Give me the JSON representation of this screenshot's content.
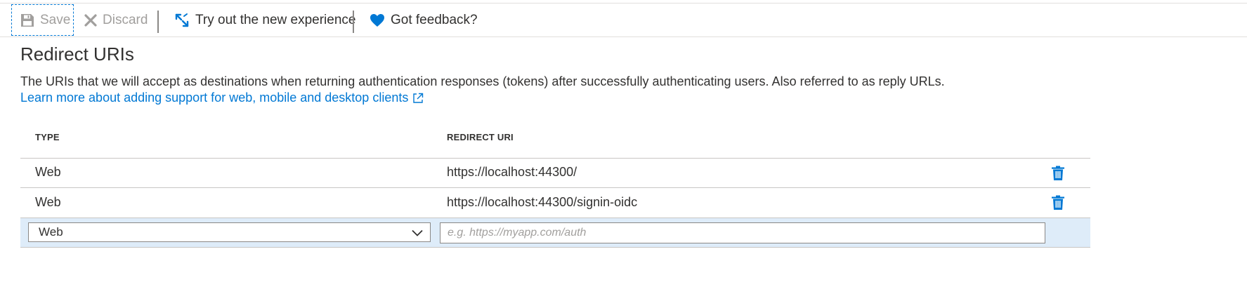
{
  "toolbar": {
    "save_label": "Save",
    "discard_label": "Discard",
    "try_label": "Try out the new experience",
    "feedback_label": "Got feedback?"
  },
  "section": {
    "title": "Redirect URIs",
    "description": "The URIs that we will accept as destinations when returning authentication responses (tokens) after successfully authenticating users. Also referred to as reply URLs.",
    "learn_more": "Learn more about adding support for web, mobile and desktop clients"
  },
  "table": {
    "headers": {
      "type": "TYPE",
      "uri": "REDIRECT URI"
    },
    "rows": [
      {
        "type": "Web",
        "uri": "https://localhost:44300/"
      },
      {
        "type": "Web",
        "uri": "https://localhost:44300/signin-oidc"
      }
    ],
    "new_row": {
      "type_value": "Web",
      "uri_placeholder": "e.g. https://myapp.com/auth"
    }
  },
  "icons": {
    "save": "save-icon",
    "discard": "close-icon",
    "try": "arrows-icon",
    "feedback": "heart-icon",
    "external": "external-link-icon",
    "delete": "trash-icon",
    "select": "chevron-down-icon"
  },
  "colors": {
    "accent": "#0078d4",
    "disabled": "#a19f9d",
    "new_row_bg": "#deecf9",
    "text": "#323130"
  }
}
